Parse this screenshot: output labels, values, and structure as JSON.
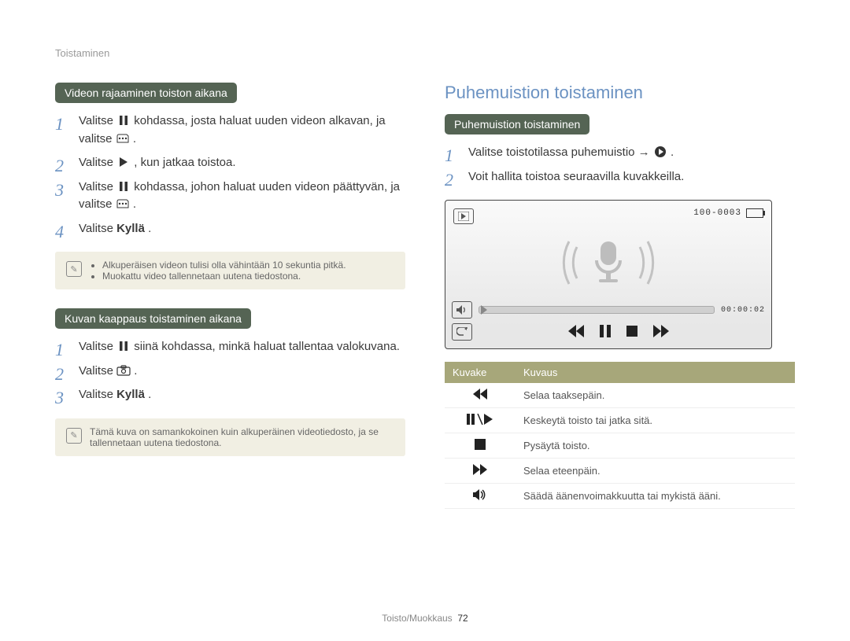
{
  "breadcrumb": "Toistaminen",
  "left": {
    "block1": {
      "pill": "Videon rajaaminen toiston aikana",
      "s1a": "Valitse ",
      "s1b": " kohdassa, josta haluat uuden videon alkavan, ja valitse ",
      "s1c": ".",
      "s2a": "Valitse ",
      "s2b": ", kun jatkaa toistoa.",
      "s3a": "Valitse ",
      "s3b": " kohdassa, johon haluat uuden videon päättyvän, ja valitse ",
      "s3c": ".",
      "s4a": "Valitse ",
      "s4b": "Kyllä",
      "s4c": ".",
      "note1": "Alkuperäisen videon tulisi olla vähintään 10 sekuntia pitkä.",
      "note2": "Muokattu video tallennetaan uutena tiedostona."
    },
    "block2": {
      "pill": "Kuvan kaappaus toistaminen aikana",
      "s1a": "Valitse ",
      "s1b": " siinä kohdassa, minkä haluat tallentaa valokuvana.",
      "s2a": "Valitse ",
      "s2b": ".",
      "s3a": "Valitse ",
      "s3b": "Kyllä",
      "s3c": ".",
      "note": "Tämä kuva on samankokoinen kuin alkuperäinen videotiedosto, ja se tallennetaan uutena tiedostona."
    }
  },
  "right": {
    "title": "Puhemuistion toistaminen",
    "pill": "Puhemuistion toistaminen",
    "s1a": "Valitse toistotilassa puhemuistio → ",
    "s1b": ".",
    "s2": "Voit hallita toistoa seuraavilla kuvakkeilla.",
    "player": {
      "file_label": "100-0003",
      "time": "00:00:02"
    },
    "table": {
      "col1": "Kuvake",
      "col2": "Kuvaus",
      "r1": "Selaa taaksepäin.",
      "r2": "Keskeytä toisto tai jatka sitä.",
      "r3": "Pysäytä toisto.",
      "r4": "Selaa eteenpäin.",
      "r5": "Säädä äänenvoimakkuutta tai mykistä ääni."
    }
  },
  "footer": {
    "section": "Toisto/Muokkaus",
    "page": "72"
  }
}
